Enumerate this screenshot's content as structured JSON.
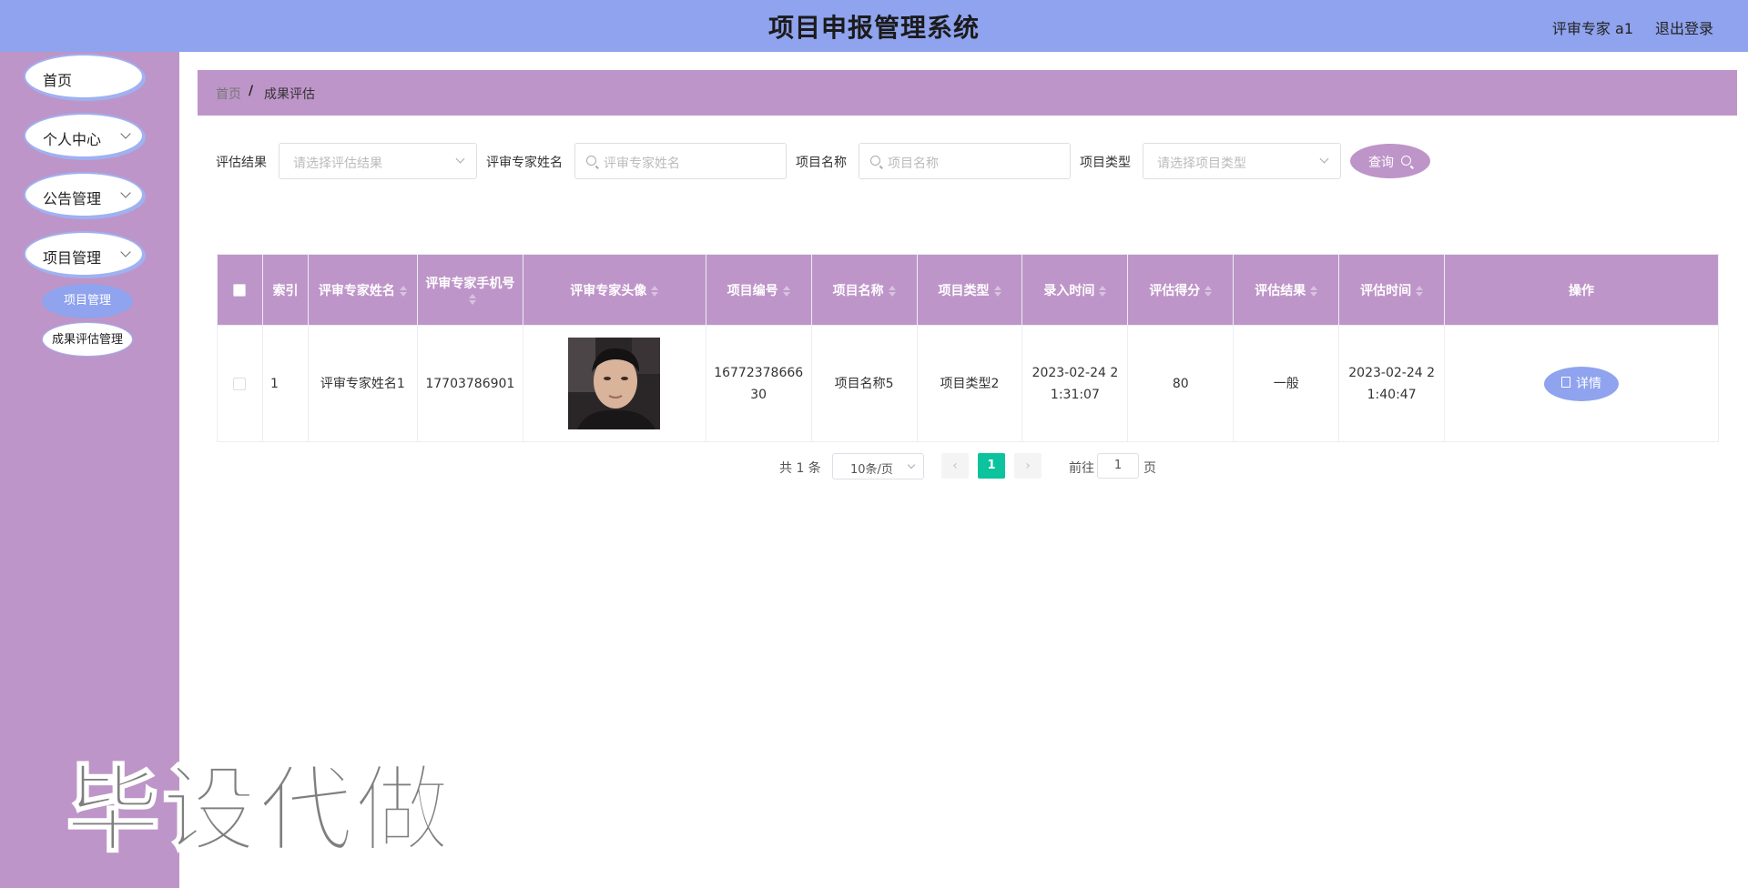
{
  "header": {
    "title": "项目申报管理系统",
    "user": "评审专家 a1",
    "logout": "退出登录"
  },
  "sidebar": {
    "items": [
      {
        "label": "首页"
      },
      {
        "label": "个人中心"
      },
      {
        "label": "公告管理"
      },
      {
        "label": "项目管理"
      }
    ],
    "sub_items": [
      {
        "label": "项目管理",
        "active": true
      },
      {
        "label": "成果评估管理",
        "active": false
      }
    ]
  },
  "watermark": "毕设代做",
  "breadcrumb": {
    "home": "首页",
    "separator": "/",
    "current": "成果评估"
  },
  "search": {
    "result_label": "评估结果",
    "result_placeholder": "请选择评估结果",
    "expert_label": "评审专家姓名",
    "expert_placeholder": "评审专家姓名",
    "project_label": "项目名称",
    "project_placeholder": "项目名称",
    "type_label": "项目类型",
    "type_placeholder": "请选择项目类型",
    "query_button": "查询"
  },
  "table": {
    "headers": {
      "index": "索引",
      "expert_name": "评审专家姓名",
      "expert_phone": "评审专家手机号",
      "expert_avatar": "评审专家头像",
      "project_no": "项目编号",
      "project_name": "项目名称",
      "project_type": "项目类型",
      "entry_time": "录入时间",
      "score": "评估得分",
      "result": "评估结果",
      "eval_time": "评估时间",
      "actions": "操作"
    },
    "rows": [
      {
        "index": "1",
        "expert_name": "评审专家姓名1",
        "expert_phone": "17703786901",
        "project_no": "1677237866630",
        "project_name": "项目名称5",
        "project_type": "项目类型2",
        "entry_time": "2023-02-24 21:31:07",
        "score": "80",
        "result": "一般",
        "eval_time": "2023-02-24 21:40:47",
        "detail_button": "详情"
      }
    ]
  },
  "pagination": {
    "total": "共 1 条",
    "page_size": "10条/页",
    "prev": "‹",
    "current_page": "1",
    "next": "›",
    "goto_label": "前往",
    "goto_value": "1",
    "page_suffix": "页"
  },
  "colors": {
    "header_bg": "#8fa3ee",
    "sidebar_bg": "#be95c8",
    "table_header_bg": "#be95c8",
    "active_page": "#0cc39d"
  }
}
